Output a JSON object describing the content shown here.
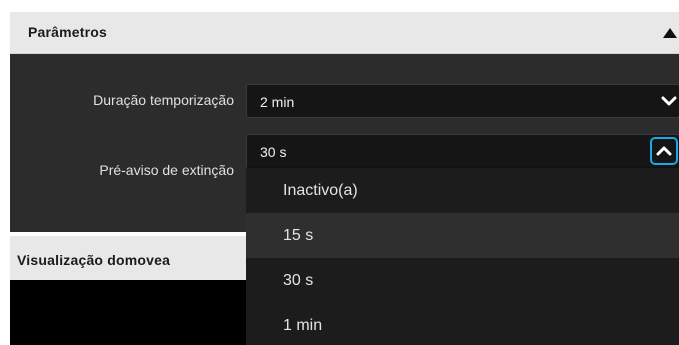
{
  "parametros": {
    "title": "Parâmetros",
    "collapse_icon": "caret-up-icon"
  },
  "settings": {
    "duracao": {
      "label": "Duração temporização",
      "value": "2 min",
      "icon": "chevron-down-icon"
    },
    "preaviso": {
      "label": "Pré-aviso de extinção",
      "value": "30 s",
      "icon": "chevron-up-icon",
      "options": [
        "Inactivo(a)",
        "15 s",
        "30 s",
        "1 min"
      ],
      "highlighted_option": "15 s"
    }
  },
  "visualizacao": {
    "title": "Visualização domovea"
  },
  "colors": {
    "accent": "#19a9e6",
    "panel_dark": "#2c2c2c",
    "header_light": "#e8e8e8"
  }
}
